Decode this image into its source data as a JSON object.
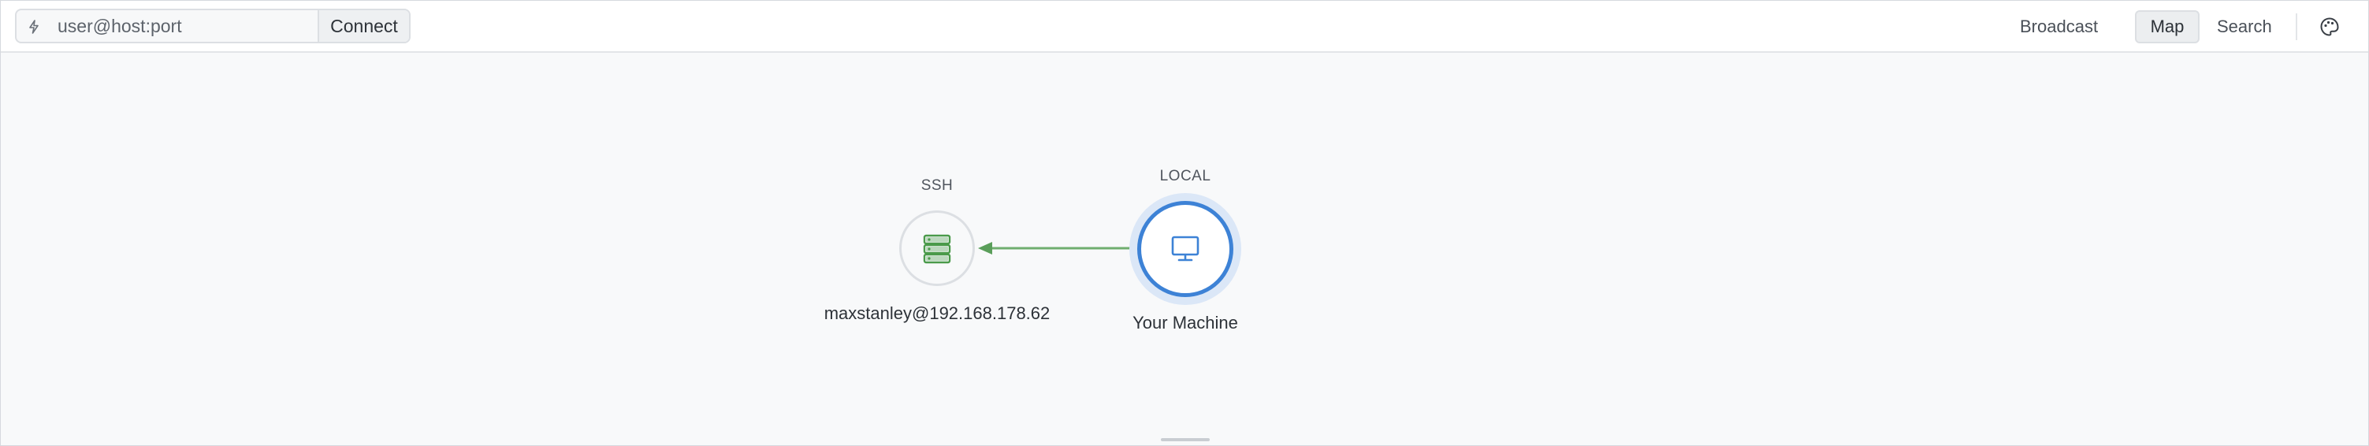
{
  "toolbar": {
    "connect_placeholder": "user@host:port",
    "connect_label": "Connect",
    "nav": {
      "broadcast": "Broadcast",
      "map": "Map",
      "search": "Search"
    },
    "active_view": "Map"
  },
  "map": {
    "nodes": [
      {
        "type_label": "SSH",
        "name": "maxstanley@192.168.178.62",
        "icon": "server-icon",
        "color": "#4a9a4a"
      },
      {
        "type_label": "LOCAL",
        "name": "Your Machine",
        "icon": "monitor-icon",
        "color": "#3d82d6"
      }
    ],
    "edge": {
      "from": "Your Machine",
      "to": "maxstanley@192.168.178.62",
      "color": "#6fae6f"
    }
  },
  "colors": {
    "accent": "#3d82d6",
    "ssh_green": "#4a9a4a",
    "background": "#f8f9fa"
  }
}
